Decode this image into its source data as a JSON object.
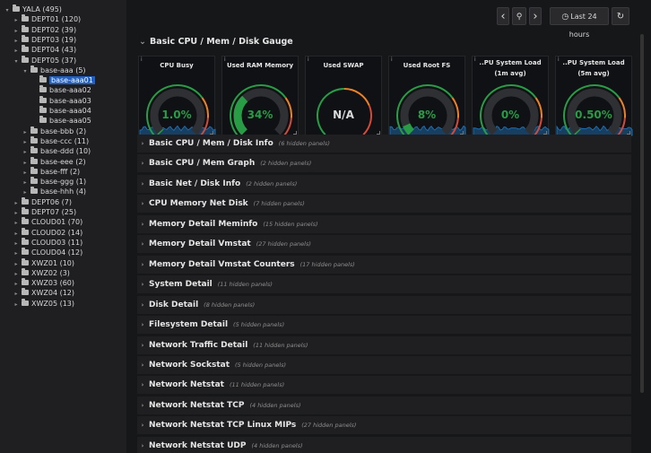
{
  "tree": {
    "items": [
      {
        "label": "YALA (495)",
        "caret": "▾"
      },
      {
        "label": "DEPT01 (120)",
        "caret": "▸"
      },
      {
        "label": "DEPT02 (39)",
        "caret": "▸"
      },
      {
        "label": "DEPT03 (19)",
        "caret": "▸"
      },
      {
        "label": "DEPT04 (43)",
        "caret": "▸"
      },
      {
        "label": "DEPT05 (37)",
        "caret": "▾"
      },
      {
        "label": "base-aaa (5)",
        "caret": "▾"
      },
      {
        "label": "base-aaa01",
        "caret": ""
      },
      {
        "label": "base-aaa02",
        "caret": ""
      },
      {
        "label": "base-aaa03",
        "caret": ""
      },
      {
        "label": "base-aaa04",
        "caret": ""
      },
      {
        "label": "base-aaa05",
        "caret": ""
      },
      {
        "label": "base-bbb (2)",
        "caret": "▸"
      },
      {
        "label": "base-ccc (11)",
        "caret": "▸"
      },
      {
        "label": "base-ddd (10)",
        "caret": "▸"
      },
      {
        "label": "base-eee (2)",
        "caret": "▸"
      },
      {
        "label": "base-fff (2)",
        "caret": "▸"
      },
      {
        "label": "base-ggg (1)",
        "caret": "▸"
      },
      {
        "label": "base-hhh (4)",
        "caret": "▸"
      },
      {
        "label": "DEPT06 (7)",
        "caret": "▸"
      },
      {
        "label": "DEPT07 (25)",
        "caret": "▸"
      },
      {
        "label": "CLOUD01 (70)",
        "caret": "▸"
      },
      {
        "label": "CLOUD02 (14)",
        "caret": "▸"
      },
      {
        "label": "CLOUD03 (11)",
        "caret": "▸"
      },
      {
        "label": "CLOUD04 (12)",
        "caret": "▸"
      },
      {
        "label": "XWZ01 (10)",
        "caret": "▸"
      },
      {
        "label": "XWZ02 (3)",
        "caret": "▸"
      },
      {
        "label": "XWZ03 (60)",
        "caret": "▸"
      },
      {
        "label": "XWZ04 (12)",
        "caret": "▸"
      },
      {
        "label": "XWZ05 (13)",
        "caret": "▸"
      }
    ]
  },
  "toolbar": {
    "prev_icon": "‹",
    "zoom_icon": "⚲",
    "next_icon": "›",
    "time_range": "Last 24 hours",
    "clock_icon": "◷",
    "refresh_icon": "↻"
  },
  "open_row": {
    "title": "Basic CPU / Mem / Disk Gauge",
    "chev": "⌄"
  },
  "panels": [
    {
      "title": "CPU Busy",
      "value": "1.0%",
      "level": 0.01,
      "color": "#299c46",
      "sparkline": true
    },
    {
      "title": "Used RAM Memory",
      "value": "34%",
      "level": 0.34,
      "color": "#299c46",
      "sparkline": false
    },
    {
      "title": "Used SWAP",
      "value": "N/A",
      "level": 0,
      "color": "#d8d9da",
      "sparkline": false
    },
    {
      "title": "Used Root FS",
      "value": "8%",
      "level": 0.08,
      "color": "#299c46",
      "sparkline": true
    },
    {
      "title": "..PU System Load (1m avg)",
      "value": "0%",
      "level": 0,
      "color": "#299c46",
      "sparkline": true
    },
    {
      "title": "..PU System Load (5m avg)",
      "value": "0.50%",
      "level": 0.005,
      "color": "#299c46",
      "sparkline": true
    }
  ],
  "rows": [
    {
      "title": "Basic CPU / Mem / Disk Info",
      "hidden": "(6 hidden panels)"
    },
    {
      "title": "Basic CPU / Mem Graph",
      "hidden": "(2 hidden panels)"
    },
    {
      "title": "Basic Net / Disk Info",
      "hidden": "(2 hidden panels)"
    },
    {
      "title": "CPU Memory Net Disk",
      "hidden": "(7 hidden panels)"
    },
    {
      "title": "Memory Detail Meminfo",
      "hidden": "(15 hidden panels)"
    },
    {
      "title": "Memory Detail Vmstat",
      "hidden": "(27 hidden panels)"
    },
    {
      "title": "Memory Detail Vmstat Counters",
      "hidden": "(17 hidden panels)"
    },
    {
      "title": "System Detail",
      "hidden": "(11 hidden panels)"
    },
    {
      "title": "Disk Detail",
      "hidden": "(8 hidden panels)"
    },
    {
      "title": "Filesystem Detail",
      "hidden": "(5 hidden panels)"
    },
    {
      "title": "Network Traffic Detail",
      "hidden": "(11 hidden panels)"
    },
    {
      "title": "Network Sockstat",
      "hidden": "(5 hidden panels)"
    },
    {
      "title": "Network Netstat",
      "hidden": "(11 hidden panels)"
    },
    {
      "title": "Network Netstat TCP",
      "hidden": "(4 hidden panels)"
    },
    {
      "title": "Network Netstat TCP Linux MIPs",
      "hidden": "(27 hidden panels)"
    },
    {
      "title": "Network Netstat UDP",
      "hidden": "(4 hidden panels)"
    }
  ],
  "info_icon": "i",
  "row_chev": "›",
  "colors": {
    "accent": "#1f60c4",
    "ok": "#299c46",
    "warn": "#ed8128",
    "crit": "#d44a3a",
    "spark": "#1f78c1"
  }
}
